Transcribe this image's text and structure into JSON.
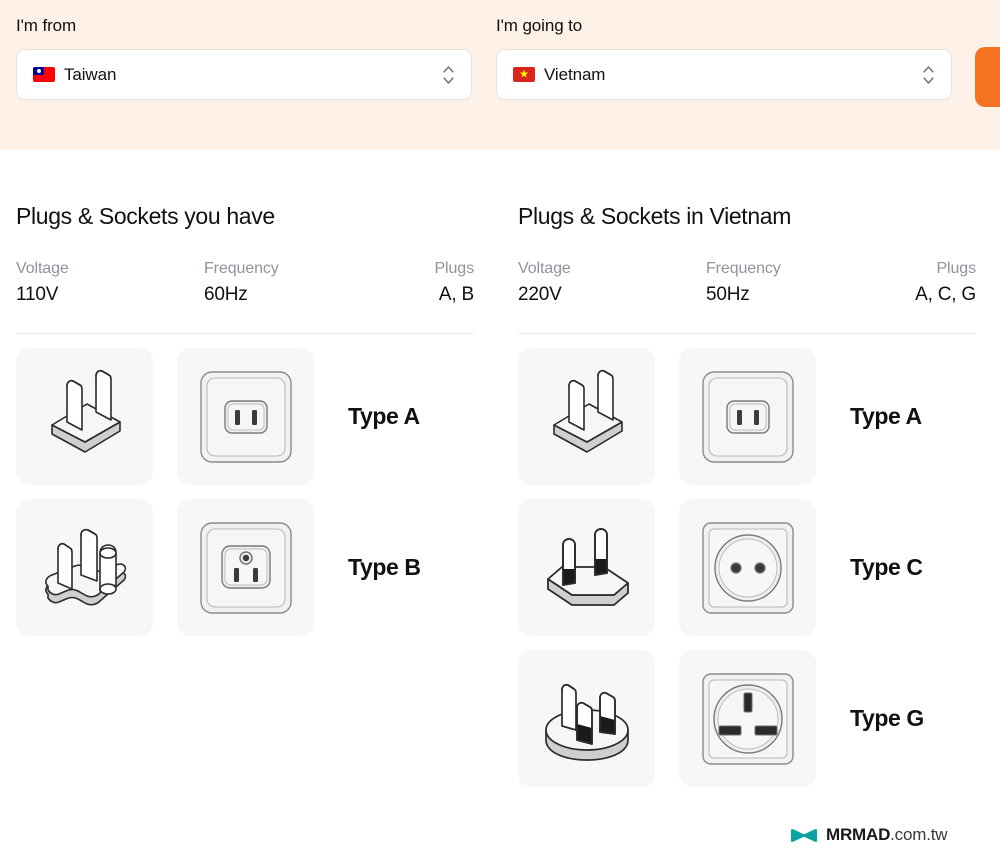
{
  "header": {
    "from": {
      "label": "I'm from",
      "country": "Taiwan",
      "flag": "taiwan-flag-icon",
      "stepper_icon": "chevron-up-down-icon"
    },
    "to": {
      "label": "I'm going to",
      "country": "Vietnam",
      "flag": "vietnam-flag-icon",
      "stepper_icon": "chevron-up-down-icon"
    },
    "cta_color": "#f47321",
    "background_color": "#fdf1e8"
  },
  "columns": [
    {
      "title": "Plugs & Sockets you have",
      "stats": {
        "voltage_label": "Voltage",
        "voltage_value": "110V",
        "frequency_label": "Frequency",
        "frequency_value": "60Hz",
        "plugs_label": "Plugs",
        "plugs_value": "A, B"
      },
      "rows": [
        {
          "type_label": "Type A",
          "plug_icon": "plug-type-a-icon",
          "socket_icon": "socket-type-a-icon"
        },
        {
          "type_label": "Type B",
          "plug_icon": "plug-type-b-icon",
          "socket_icon": "socket-type-b-icon"
        }
      ]
    },
    {
      "title": "Plugs & Sockets in Vietnam",
      "stats": {
        "voltage_label": "Voltage",
        "voltage_value": "220V",
        "frequency_label": "Frequency",
        "frequency_value": "50Hz",
        "plugs_label": "Plugs",
        "plugs_value": "A, C, G"
      },
      "rows": [
        {
          "type_label": "Type A",
          "plug_icon": "plug-type-a-icon",
          "socket_icon": "socket-type-a-icon"
        },
        {
          "type_label": "Type C",
          "plug_icon": "plug-type-c-icon",
          "socket_icon": "socket-type-c-icon"
        },
        {
          "type_label": "Type G",
          "plug_icon": "plug-type-g-icon",
          "socket_icon": "socket-type-g-icon"
        }
      ]
    }
  ],
  "watermark": {
    "brand": "MRMAD",
    "domain": ".com.tw",
    "mark_color": "#0aa3a0"
  }
}
